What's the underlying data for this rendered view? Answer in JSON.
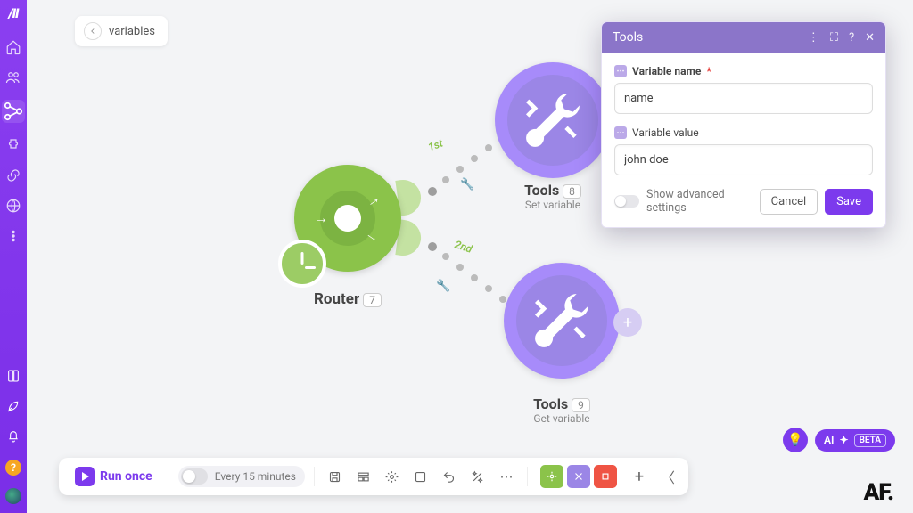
{
  "breadcrumb": {
    "title": "variables"
  },
  "nodes": {
    "router": {
      "label": "Router",
      "count": "7"
    },
    "tools1": {
      "label": "Tools",
      "count": "8",
      "sub": "Set variable"
    },
    "tools2": {
      "label": "Tools",
      "count": "9",
      "sub": "Get variable"
    }
  },
  "connectors": {
    "first": "1st",
    "second": "2nd"
  },
  "panel": {
    "title": "Tools",
    "var_name_label": "Variable name",
    "var_name_value": "name",
    "var_value_label": "Variable value",
    "var_value_value": "john doe",
    "advanced_label": "Show advanced settings",
    "cancel": "Cancel",
    "save": "Save"
  },
  "bottombar": {
    "run": "Run once",
    "schedule": "Every 15 minutes"
  },
  "ai": {
    "label": "AI",
    "beta": "BETA"
  },
  "watermark": "AF.",
  "colors": {
    "purple": "#7c3aed",
    "green": "#8bc34a"
  }
}
